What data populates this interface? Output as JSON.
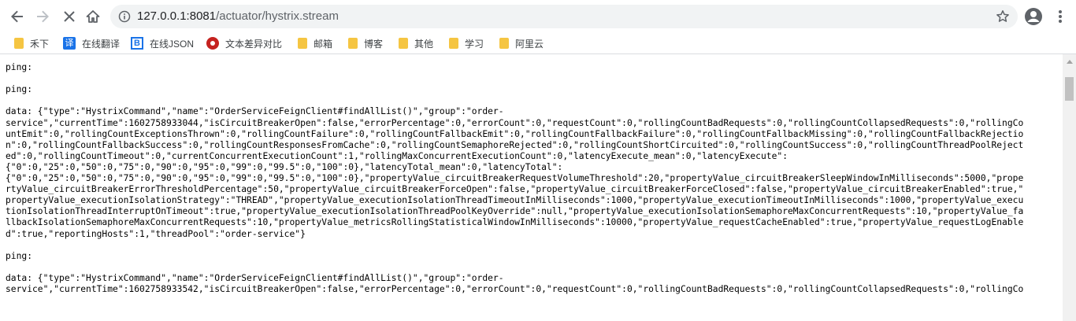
{
  "browser": {
    "url_host": "127.0.0.1:8081",
    "url_path": "/actuator/hystrix.stream",
    "icons": [
      "back-icon",
      "forward-icon",
      "stop-icon",
      "home-icon",
      "info-icon",
      "star-icon",
      "account-icon",
      "more-menu-icon"
    ]
  },
  "bookmarks": [
    {
      "label": "禾下",
      "icon": "folder"
    },
    {
      "label": "在线翻译",
      "icon": "translate"
    },
    {
      "label": "在线JSON",
      "icon": "json"
    },
    {
      "label": "文本差异对比",
      "icon": "diff"
    },
    {
      "label": "邮箱",
      "icon": "folder"
    },
    {
      "label": "博客",
      "icon": "folder"
    },
    {
      "label": "其他",
      "icon": "folder"
    },
    {
      "label": "学习",
      "icon": "folder"
    },
    {
      "label": "阿里云",
      "icon": "folder"
    }
  ],
  "stream_lines": [
    "",
    "ping: ",
    "",
    "ping: ",
    "",
    "data: {\"type\":\"HystrixCommand\",\"name\":\"OrderServiceFeignClient#findAllList()\",\"group\":\"order-",
    "service\",\"currentTime\":1602758933044,\"isCircuitBreakerOpen\":false,\"errorPercentage\":0,\"errorCount\":0,\"requestCount\":0,\"rollingCountBadRequests\":0,\"rollingCountCollapsedRequests\":0,\"rollingCo",
    "untEmit\":0,\"rollingCountExceptionsThrown\":0,\"rollingCountFailure\":0,\"rollingCountFallbackEmit\":0,\"rollingCountFallbackFailure\":0,\"rollingCountFallbackMissing\":0,\"rollingCountFallbackRejectio",
    "n\":0,\"rollingCountFallbackSuccess\":0,\"rollingCountResponsesFromCache\":0,\"rollingCountSemaphoreRejected\":0,\"rollingCountShortCircuited\":0,\"rollingCountSuccess\":0,\"rollingCountThreadPoolReject",
    "ed\":0,\"rollingCountTimeout\":0,\"currentConcurrentExecutionCount\":1,\"rollingMaxConcurrentExecutionCount\":0,\"latencyExecute_mean\":0,\"latencyExecute\":",
    "{\"0\":0,\"25\":0,\"50\":0,\"75\":0,\"90\":0,\"95\":0,\"99\":0,\"99.5\":0,\"100\":0},\"latencyTotal_mean\":0,\"latencyTotal\":",
    "{\"0\":0,\"25\":0,\"50\":0,\"75\":0,\"90\":0,\"95\":0,\"99\":0,\"99.5\":0,\"100\":0},\"propertyValue_circuitBreakerRequestVolumeThreshold\":20,\"propertyValue_circuitBreakerSleepWindowInMilliseconds\":5000,\"prope",
    "rtyValue_circuitBreakerErrorThresholdPercentage\":50,\"propertyValue_circuitBreakerForceOpen\":false,\"propertyValue_circuitBreakerForceClosed\":false,\"propertyValue_circuitBreakerEnabled\":true,\"",
    "propertyValue_executionIsolationStrategy\":\"THREAD\",\"propertyValue_executionIsolationThreadTimeoutInMilliseconds\":1000,\"propertyValue_executionTimeoutInMilliseconds\":1000,\"propertyValue_execu",
    "tionIsolationThreadInterruptOnTimeout\":true,\"propertyValue_executionIsolationThreadPoolKeyOverride\":null,\"propertyValue_executionIsolationSemaphoreMaxConcurrentRequests\":10,\"propertyValue_fa",
    "llbackIsolationSemaphoreMaxConcurrentRequests\":10,\"propertyValue_metricsRollingStatisticalWindowInMilliseconds\":10000,\"propertyValue_requestCacheEnabled\":true,\"propertyValue_requestLogEnable",
    "d\":true,\"reportingHosts\":1,\"threadPool\":\"order-service\"}",
    "",
    "ping: ",
    "",
    "data: {\"type\":\"HystrixCommand\",\"name\":\"OrderServiceFeignClient#findAllList()\",\"group\":\"order-",
    "service\",\"currentTime\":1602758933542,\"isCircuitBreakerOpen\":false,\"errorPercentage\":0,\"errorCount\":0,\"requestCount\":0,\"rollingCountBadRequests\":0,\"rollingCountCollapsedRequests\":0,\"rollingCo"
  ]
}
